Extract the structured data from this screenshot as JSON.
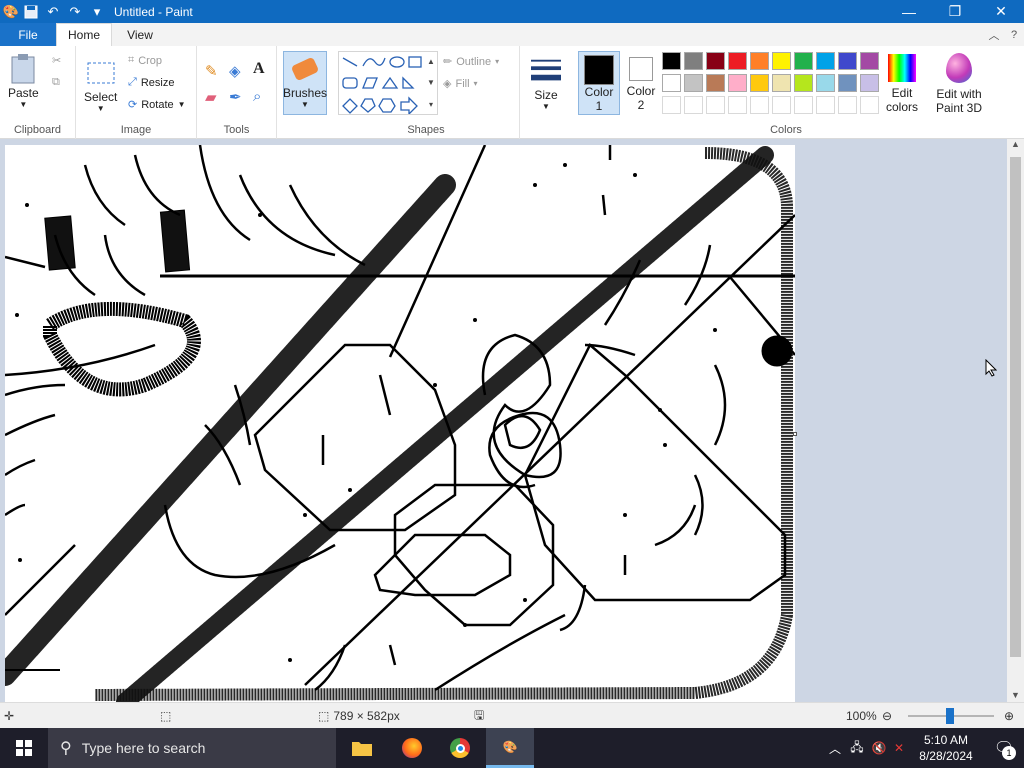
{
  "window": {
    "title": "Untitled - Paint",
    "minimize": "—",
    "maximize": "❐",
    "close": "✕"
  },
  "tabs": {
    "file": "File",
    "home": "Home",
    "view": "View"
  },
  "ribbon": {
    "clipboard": {
      "label": "Clipboard",
      "paste": "Paste"
    },
    "image": {
      "label": "Image",
      "select": "Select",
      "crop": "Crop",
      "resize": "Resize",
      "rotate": "Rotate"
    },
    "tools": {
      "label": "Tools"
    },
    "brushes": {
      "label": "Brushes"
    },
    "shapes": {
      "label": "Shapes",
      "outline": "Outline",
      "fill": "Fill"
    },
    "size": {
      "label": "Size"
    },
    "colors": {
      "label": "Colors",
      "color1_line1": "Color",
      "color1_line2": "1",
      "color2_line1": "Color",
      "color2_line2": "2",
      "edit_colors_line1": "Edit",
      "edit_colors_line2": "colors",
      "paint3d_line1": "Edit with",
      "paint3d_line2": "Paint 3D",
      "palette_row1": [
        "#000000",
        "#7f7f7f",
        "#880015",
        "#ed1c24",
        "#ff7f27",
        "#fff200",
        "#22b14c",
        "#00a2e8",
        "#3f48cc",
        "#a349a4"
      ],
      "palette_row2": [
        "#ffffff",
        "#c3c3c3",
        "#b97a57",
        "#ffaec9",
        "#ffc90e",
        "#efe4b0",
        "#b5e61d",
        "#99d9ea",
        "#7092be",
        "#c8bfe7"
      ]
    }
  },
  "status": {
    "dimensions": "789 × 582px",
    "zoom": "100%"
  },
  "taskbar": {
    "search_placeholder": "Type here to search",
    "time": "5:10 AM",
    "date": "8/28/2024",
    "notification_count": "1"
  }
}
